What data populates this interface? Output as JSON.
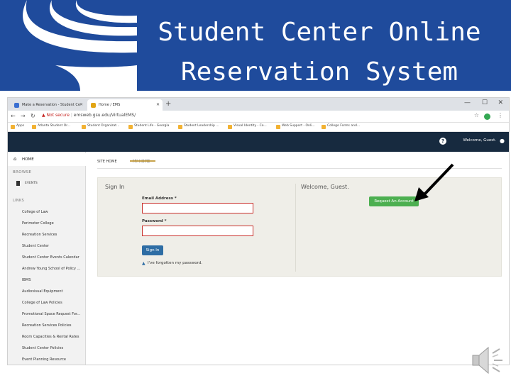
{
  "slide": {
    "title_line1": "Student Center Online",
    "title_line2": "Reservation System",
    "colors": {
      "header_bg": "#1f4b9c",
      "nav_bg": "#172a3f",
      "accent_green": "#4caf50",
      "accent_blue": "#2e6da4"
    }
  },
  "browser": {
    "tabs": [
      {
        "label": "Make a Reservation - Student Ce"
      },
      {
        "label": "Home / EMS"
      }
    ],
    "new_tab": "+",
    "window_controls": [
      "—",
      "☐",
      "✕"
    ],
    "address": {
      "warning": "Not secure",
      "url": "emsweb.gsu.edu/VirtualEMS/"
    },
    "bookmarks": [
      "Apps",
      "Atlanta Student Or...",
      "Student Organizat...",
      "Student Life - Georgia",
      "Student Leadership ...",
      "Visual Identity - Co...",
      "Web Support - Onli...",
      "College Forms and..."
    ]
  },
  "app": {
    "header": {
      "welcome": "Welcome, Guest."
    },
    "sidebar": {
      "home": "HOME",
      "browse_heading": "BROWSE",
      "events": "EVENTS",
      "links_heading": "LINKS",
      "links": [
        "College of Law",
        "Perimeter College",
        "Recreation Services",
        "Student Center",
        "Student Center Events Calendar",
        "Andrew Young School of Policy ...",
        "IBMS",
        "Audiovisual Equipment",
        "College of Law Policies",
        "Promotional Space Request For...",
        "Recreation Services Policies",
        "Room Capacities & Rental Rates",
        "Student Center Policies",
        "Event Planning Resource"
      ]
    },
    "tabs": {
      "site_home": "SITE HOME",
      "my_home": "MY HOME"
    },
    "signin": {
      "title": "Sign In",
      "email_label": "Email Address *",
      "email_value": "",
      "password_label": "Password *",
      "password_value": "",
      "button": "Sign In",
      "forgot": "I've forgotten my password."
    },
    "welcome": {
      "title": "Welcome, Guest.",
      "request_button": "Request An Account"
    }
  }
}
